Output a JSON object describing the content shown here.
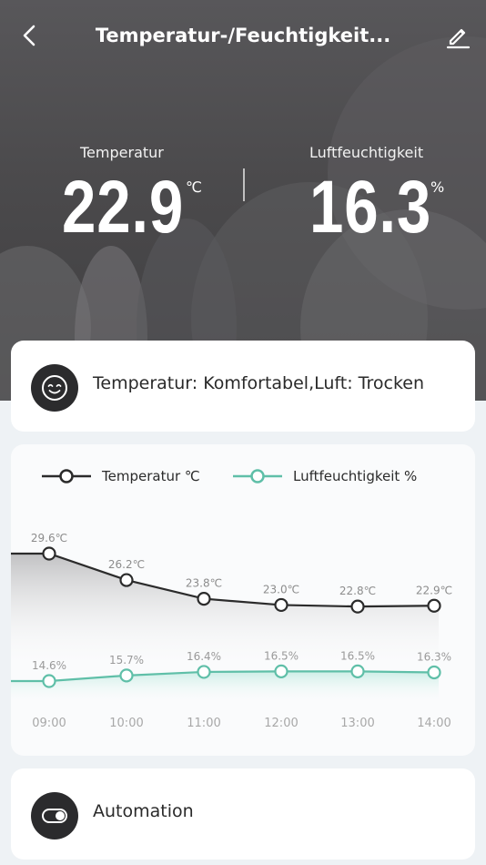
{
  "header": {
    "title": "Temperatur-/Feuchtigkeit...",
    "back_icon": "chevron-left-icon",
    "edit_icon": "pencil-icon"
  },
  "readings": {
    "temperature": {
      "label": "Temperatur",
      "value": "22.9",
      "unit": "℃"
    },
    "humidity": {
      "label": "Luftfeuchtigkeit",
      "value": "16.3",
      "unit": "%"
    }
  },
  "comfort": {
    "icon": "smiley-face-icon",
    "text": "Temperatur: Komfortabel,Luft: Trocken"
  },
  "automation": {
    "icon": "toggle-icon",
    "label": "Automation"
  },
  "colors": {
    "temperature_line": "#2b2b2b",
    "humidity_line": "#5fbfa8",
    "hero_background": "#4b4a4c"
  },
  "chart_data": {
    "type": "line",
    "categories": [
      "09:00",
      "10:00",
      "11:00",
      "12:00",
      "13:00",
      "14:00"
    ],
    "series": [
      {
        "name": "Temperatur ℃",
        "values": [
          29.6,
          26.2,
          23.8,
          23.0,
          22.8,
          22.9
        ],
        "labels": [
          "29.6℃",
          "26.2℃",
          "23.8℃",
          "23.0℃",
          "22.8℃",
          "22.9℃"
        ],
        "color": "#2b2b2b"
      },
      {
        "name": "Luftfeuchtigkeit %",
        "values": [
          14.6,
          15.7,
          16.4,
          16.5,
          16.5,
          16.3
        ],
        "labels": [
          "14.6%",
          "15.7%",
          "16.4%",
          "16.5%",
          "16.5%",
          "16.3%"
        ],
        "color": "#5fbfa8"
      }
    ],
    "legend": "top-left",
    "grid": false
  }
}
